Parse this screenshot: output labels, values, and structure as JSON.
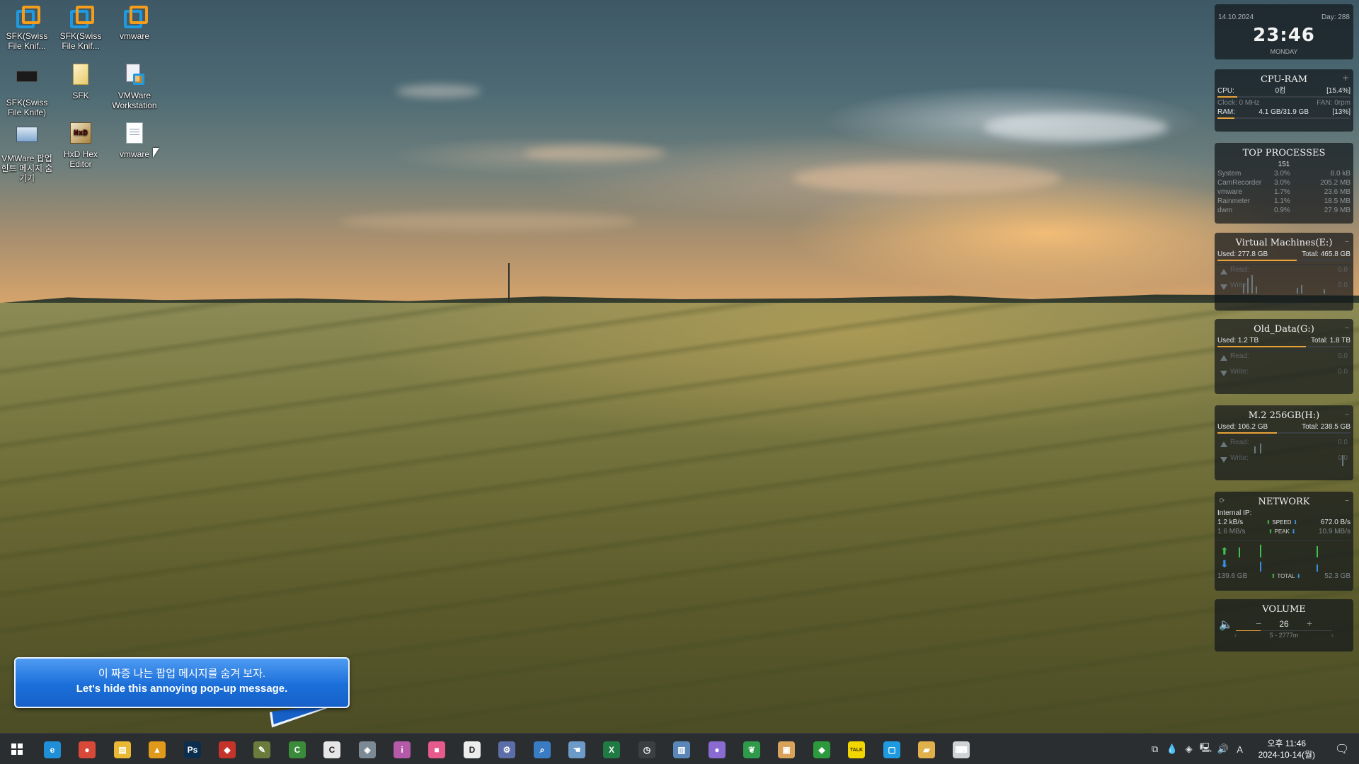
{
  "desktop_icons": [
    {
      "label": "SFK(Swiss File Knif...",
      "icon": "vmware-icon"
    },
    {
      "label": "SFK(Swiss File Knif...",
      "icon": "vmware-icon"
    },
    {
      "label": "vmware",
      "icon": "vmware-icon"
    },
    {
      "label": "SFK(Swiss File Knife)",
      "icon": "exe-icon"
    },
    {
      "label": "SFK",
      "icon": "file-icon"
    },
    {
      "label": "VMWare Workstation",
      "icon": "vmware-shortcut-icon"
    },
    {
      "label": "VMWare 팝업 힌트 메시지 숨기기",
      "icon": "vmware-hint-icon"
    },
    {
      "label": "HxD Hex Editor",
      "icon": "hxd-icon"
    },
    {
      "label": "vmware",
      "icon": "text-file-icon"
    }
  ],
  "clock_widget": {
    "date": "14.10.2024",
    "day": "Day: 288",
    "time": "23:46",
    "weekday": "MONDAY"
  },
  "cpu_ram": {
    "title": "CPU-RAM",
    "cpu_label": "CPU:",
    "cpu_name": "0컴",
    "cpu_pct": "[15.4%]",
    "clock": "Clock: 0 MHz",
    "fan": "FAN: 0rpm",
    "ram_label": "RAM:",
    "ram_value": "4.1 GB/31.9 GB",
    "ram_pct": "[13%]"
  },
  "top_processes": {
    "title": "TOP PROCESSES",
    "count": "151",
    "rows": [
      {
        "name": "System",
        "cpu": "3.0%",
        "mem": "8.0 kB"
      },
      {
        "name": "CamRecorder",
        "cpu": "3.0%",
        "mem": "205.2 MB"
      },
      {
        "name": "vmware",
        "cpu": "1.7%",
        "mem": "23.6 MB"
      },
      {
        "name": "Rainmeter",
        "cpu": "1.1%",
        "mem": "18.5 MB"
      },
      {
        "name": "dwm",
        "cpu": "0.9%",
        "mem": "27.9 MB"
      }
    ]
  },
  "drives": [
    {
      "title": "Virtual Machines(E:)",
      "used": "Used: 277.8 GB",
      "total": "Total: 465.8 GB",
      "usage_fraction": 0.596,
      "read": "Read:",
      "write": "Write:",
      "read_val": "0.0",
      "write_val": "0.0"
    },
    {
      "title": "Old_Data(G:)",
      "used": "Used: 1.2 TB",
      "total": "Total: 1.8 TB",
      "usage_fraction": 0.667,
      "read": "Read:",
      "write": "Write:",
      "read_val": "0.0",
      "write_val": "0.0"
    },
    {
      "title": "M.2 256GB(H:)",
      "used": "Used: 106.2 GB",
      "total": "Total: 238.5 GB",
      "usage_fraction": 0.445,
      "read": "Read:",
      "write": "Write:",
      "read_val": "0.0",
      "write_val": "0.0"
    }
  ],
  "network": {
    "title": "NETWORK",
    "internal_ip": "Internal IP:",
    "up_rate": "1.2 kB/s",
    "speed_label": "SPEED",
    "speed_val": "672.0 B/s",
    "down_rate": "1.6 MB/s",
    "peak_label": "PEAK",
    "peak_val": "10.9 MB/s",
    "total_left": "139.6 GB",
    "total_label": "TOTAL",
    "total_right": "52.3 GB"
  },
  "volume": {
    "title": "VOLUME",
    "level": "26",
    "minus": "−",
    "plus": "+",
    "device": "5 - 2777m"
  },
  "popup": {
    "line1": "이 짜증 나는 팝업 메시지를 숨겨 보자.",
    "line2": "Let's hide this annoying pop-up message."
  },
  "taskbar": {
    "apps": [
      {
        "name": "edge",
        "glyph": "e",
        "color": "#1f8fd8"
      },
      {
        "name": "chrome",
        "glyph": "●",
        "color": "#d9493a"
      },
      {
        "name": "explorer",
        "glyph": "▤",
        "color": "#e9b934"
      },
      {
        "name": "app-orange",
        "glyph": "▲",
        "color": "#e09a1b"
      },
      {
        "name": "photoshop",
        "glyph": "Ps",
        "color": "#0b2e4f"
      },
      {
        "name": "app-red",
        "glyph": "◆",
        "color": "#c5342a"
      },
      {
        "name": "app-brush",
        "glyph": "✎",
        "color": "#6b7b3c"
      },
      {
        "name": "app-green-c",
        "glyph": "C",
        "color": "#3a8c3a"
      },
      {
        "name": "app-white-c",
        "glyph": "C",
        "color": "#e6e6e6"
      },
      {
        "name": "app-diamond",
        "glyph": "◈",
        "color": "#7c8a96"
      },
      {
        "name": "app-info",
        "glyph": "i",
        "color": "#b45aa8"
      },
      {
        "name": "app-pink",
        "glyph": "■",
        "color": "#e75a8c"
      },
      {
        "name": "app-d",
        "glyph": "D",
        "color": "#ededed"
      },
      {
        "name": "app-tools",
        "glyph": "⚙",
        "color": "#5b6ea8"
      },
      {
        "name": "app-search",
        "glyph": "⌕",
        "color": "#3a7cc4"
      },
      {
        "name": "app-hand",
        "glyph": "☚",
        "color": "#6d9bc9"
      },
      {
        "name": "excel",
        "glyph": "X",
        "color": "#1f7a43"
      },
      {
        "name": "app-clock",
        "glyph": "◷",
        "color": "#3b3f42"
      },
      {
        "name": "app-notes",
        "glyph": "▥",
        "color": "#5a87b8"
      },
      {
        "name": "app-ball",
        "glyph": "●",
        "color": "#8a6bd1"
      },
      {
        "name": "app-leaf",
        "glyph": "❦",
        "color": "#2f9a4a"
      },
      {
        "name": "app-paper",
        "glyph": "▣",
        "color": "#d9a25a"
      },
      {
        "name": "app-green-diamond",
        "glyph": "◆",
        "color": "#2c9a3c"
      },
      {
        "name": "kakaotalk",
        "glyph": "TALK",
        "color": "#f2d600"
      },
      {
        "name": "vmware",
        "glyph": "▢",
        "color": "#1e9be0"
      },
      {
        "name": "app-folder",
        "glyph": "▰",
        "color": "#e0b04a"
      },
      {
        "name": "app-keyboard",
        "glyph": "⌨",
        "color": "#cfd3d6"
      }
    ],
    "tray_time": "오후 11:46",
    "tray_date": "2024-10-14(월)",
    "ime": "A"
  }
}
